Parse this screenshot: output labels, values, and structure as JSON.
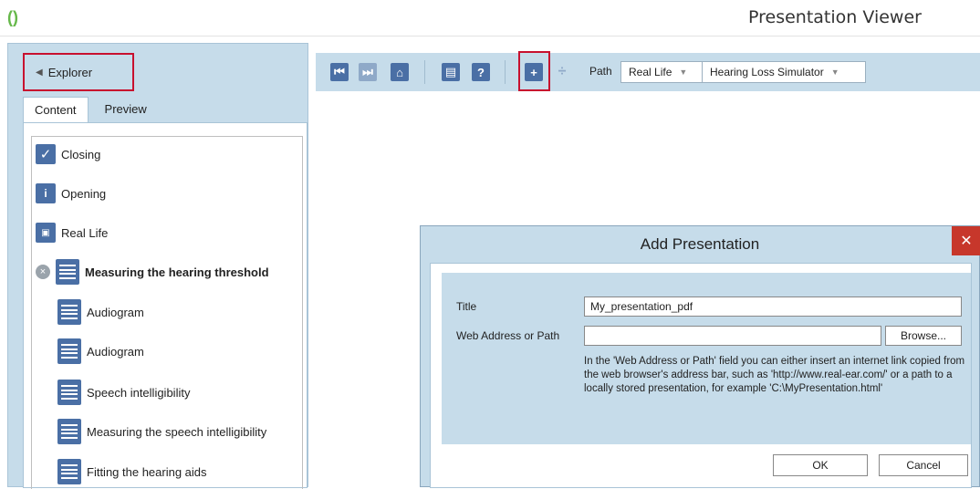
{
  "window": {
    "title": "Presentation Viewer"
  },
  "explorer": {
    "label": "Explorer"
  },
  "tabs": [
    {
      "label": "Content"
    },
    {
      "label": "Preview"
    }
  ],
  "tree": {
    "items": [
      {
        "label": "Closing",
        "icon": "checkmark-icon"
      },
      {
        "label": "Opening",
        "icon": "info-icon"
      },
      {
        "label": "Real Life",
        "icon": "real-life-icon"
      },
      {
        "label": "Measuring the hearing threshold",
        "icon": "document-icon"
      },
      {
        "label": "Audiogram",
        "icon": "document-icon"
      },
      {
        "label": "Audiogram",
        "icon": "document-icon"
      },
      {
        "label": "Speech intelligibility",
        "icon": "document-icon"
      },
      {
        "label": "Measuring the speech intelligibility",
        "icon": "document-icon"
      },
      {
        "label": "Fitting the hearing aids",
        "icon": "document-icon"
      }
    ]
  },
  "toolbar": {
    "path_label": "Path",
    "path_segments": [
      "Real Life",
      "Hearing Loss Simulator"
    ]
  },
  "dialog": {
    "title": "Add Presentation",
    "title_field_label": "Title",
    "title_value": "My_presentation_pdf",
    "path_field_label": "Web Address or Path",
    "path_value": "",
    "browse_label": "Browse...",
    "help_text": "In the 'Web Address or Path' field you can either insert an internet link copied from the web browser's address bar, such as 'http://www.real-ear.com/' or a path to a locally stored presentation, for example 'C:\\MyPresentation.html'",
    "ok_label": "OK",
    "cancel_label": "Cancel"
  },
  "colors": {
    "panel": "#c6dcea",
    "icon_blue": "#4a6fa5",
    "highlight_red": "#c8102e",
    "close_red": "#c7372b"
  }
}
